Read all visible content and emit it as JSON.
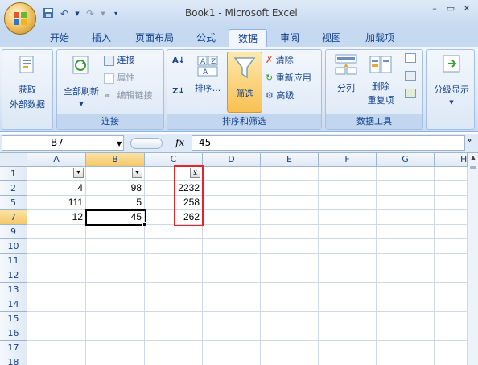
{
  "window": {
    "title": "Book1 - Microsoft Excel"
  },
  "qat": {
    "save_icon": "save-icon",
    "undo_icon": "undo-icon",
    "redo_icon": "redo-icon"
  },
  "tabs": [
    "开始",
    "插入",
    "页面布局",
    "公式",
    "数据",
    "审阅",
    "视图",
    "加载项"
  ],
  "active_tab": "数据",
  "ribbon": {
    "get_external": {
      "line1": "获取",
      "line2": "外部数据"
    },
    "connections": {
      "refresh_all": "全部刷新",
      "connections": "连接",
      "properties": "属性",
      "edit_links": "编辑链接",
      "group_label": "连接"
    },
    "sort_filter": {
      "sort": "排序...",
      "filter": "筛选",
      "clear": "清除",
      "reapply": "重新应用",
      "advanced": "高级",
      "group_label": "排序和筛选"
    },
    "data_tools": {
      "text_to_columns": "分列",
      "remove_dup_line1": "删除",
      "remove_dup_line2": "重复项",
      "group_label": "数据工具"
    },
    "outline": {
      "label": "分级显示"
    }
  },
  "formula_bar": {
    "name_box": "B7",
    "fx": "fx",
    "value": "45"
  },
  "sheet": {
    "columns": [
      "A",
      "B",
      "C",
      "D",
      "E",
      "F",
      "G",
      "H"
    ],
    "selected_column": "B",
    "rows": [
      "1",
      "2",
      "5",
      "7",
      "9",
      "10",
      "11",
      "12",
      "13",
      "14",
      "15",
      "16",
      "17",
      "18"
    ],
    "selected_row": "7",
    "cells": {
      "A2": "4",
      "B2": "98",
      "C2": "2232",
      "A5": "111",
      "B5": "5",
      "C5": "258",
      "A7": "12",
      "B7": "45",
      "C7": "262"
    },
    "filter_buttons": [
      "A1",
      "B1",
      "C1"
    ],
    "filtered_column": "C",
    "highlight_color": "#e2242c"
  }
}
